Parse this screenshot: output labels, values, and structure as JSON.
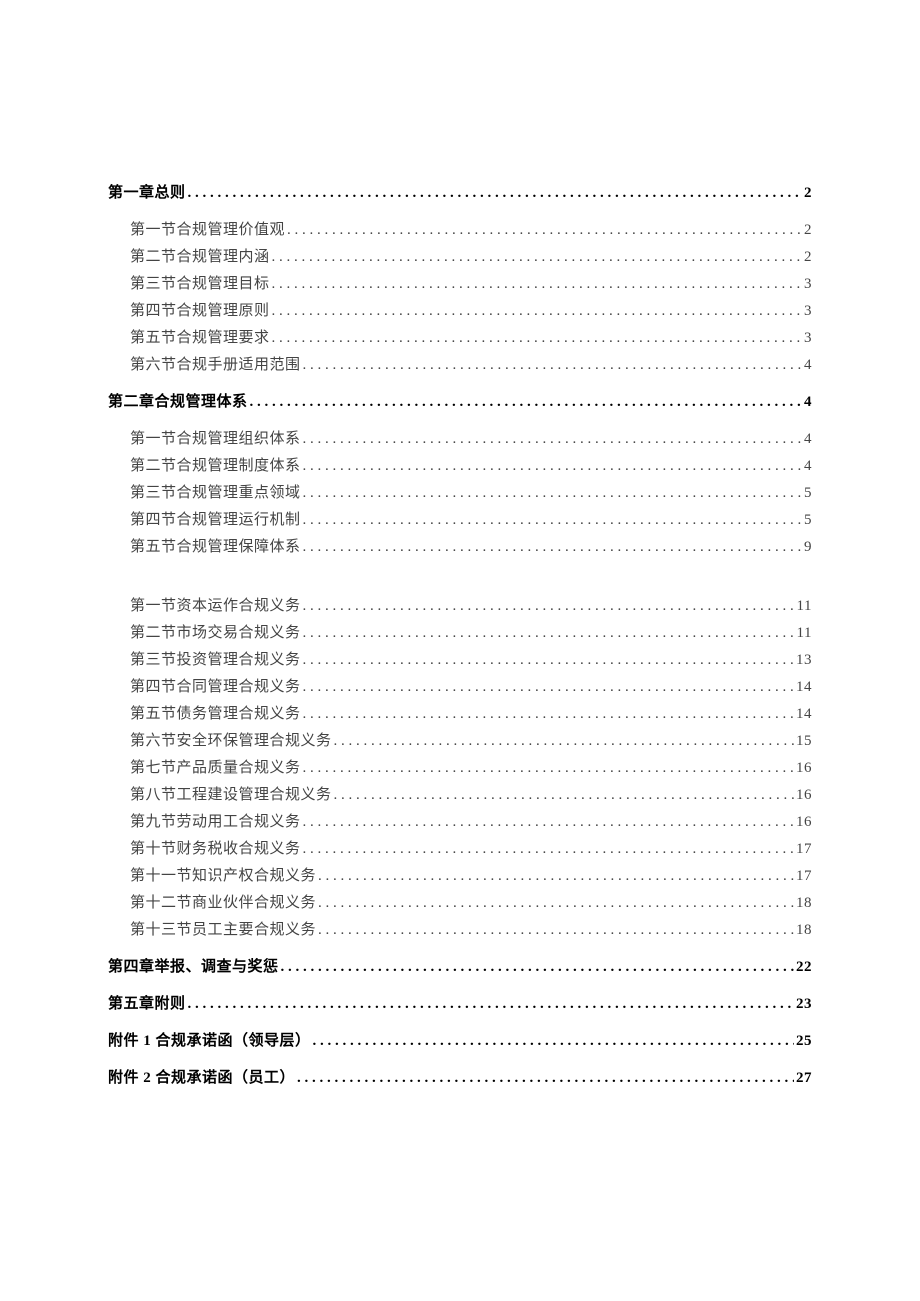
{
  "toc": [
    {
      "level": 1,
      "label": "第一章总则",
      "page": "2"
    },
    {
      "level": 2,
      "label": "第一节合规管理价值观",
      "page": "2"
    },
    {
      "level": 2,
      "label": "第二节合规管理内涵",
      "page": "2"
    },
    {
      "level": 2,
      "label": "第三节合规管理目标",
      "page": "3"
    },
    {
      "level": 2,
      "label": "第四节合规管理原则",
      "page": "3"
    },
    {
      "level": 2,
      "label": "第五节合规管理要求",
      "page": "3"
    },
    {
      "level": 2,
      "label": "第六节合规手册适用范围",
      "page": "4"
    },
    {
      "level": 1,
      "label": "第二章合规管理体系",
      "page": "4"
    },
    {
      "level": 2,
      "label": "第一节合规管理组织体系",
      "page": "4"
    },
    {
      "level": 2,
      "label": "第二节合规管理制度体系",
      "page": "4"
    },
    {
      "level": 2,
      "label": "第三节合规管理重点领域",
      "page": "5"
    },
    {
      "level": 2,
      "label": "第四节合规管理运行机制",
      "page": "5"
    },
    {
      "level": 2,
      "label": "第五节合规管理保障体系",
      "page": "9"
    },
    {
      "level": 0,
      "gap": true
    },
    {
      "level": 2,
      "label": "第一节资本运作合规义务",
      "page": "11"
    },
    {
      "level": 2,
      "label": "第二节市场交易合规义务",
      "page": "11"
    },
    {
      "level": 2,
      "label": "第三节投资管理合规义务",
      "page": "13"
    },
    {
      "level": 2,
      "label": "第四节合同管理合规义务",
      "page": "14"
    },
    {
      "level": 2,
      "label": "第五节债务管理合规义务",
      "page": "14"
    },
    {
      "level": 2,
      "label": "第六节安全环保管理合规义务",
      "page": "15"
    },
    {
      "level": 2,
      "label": "第七节产品质量合规义务",
      "page": "16"
    },
    {
      "level": 2,
      "label": "第八节工程建设管理合规义务",
      "page": "16"
    },
    {
      "level": 2,
      "label": "第九节劳动用工合规义务",
      "page": "16"
    },
    {
      "level": 2,
      "label": "第十节财务税收合规义务",
      "page": "17"
    },
    {
      "level": 2,
      "label": "第十一节知识产权合规义务",
      "page": "17"
    },
    {
      "level": 2,
      "label": "第十二节商业伙伴合规义务",
      "page": "18"
    },
    {
      "level": 2,
      "label": "第十三节员工主要合规义务",
      "page": "18"
    },
    {
      "level": 1,
      "label": "第四章举报、调查与奖惩",
      "page": "22"
    },
    {
      "level": 1,
      "label": "第五章附则",
      "page": "23"
    },
    {
      "level": 1,
      "label": "附件 1 合规承诺函（领导层）",
      "page": "25"
    },
    {
      "level": 1,
      "label": "附件 2 合规承诺函（员工）",
      "page": "27"
    }
  ]
}
